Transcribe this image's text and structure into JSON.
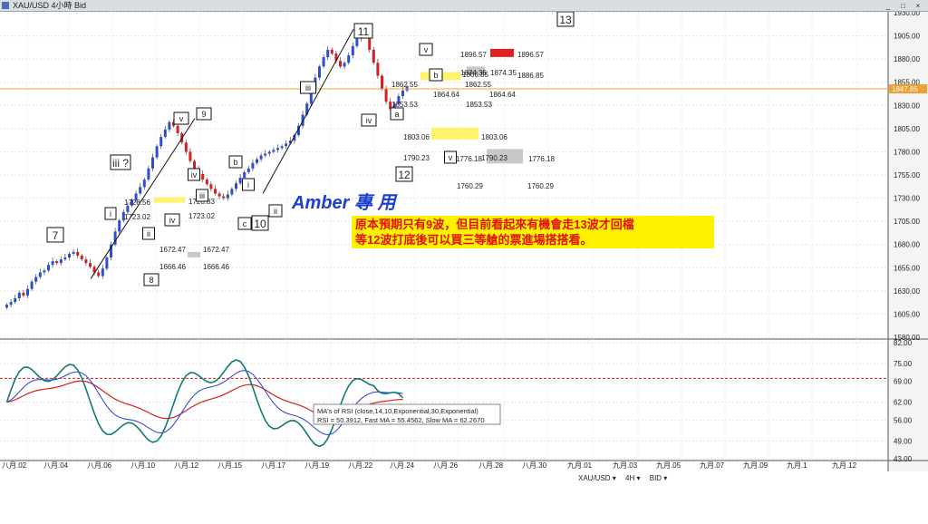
{
  "window": {
    "title": "XAU/USD 4小時 Bid",
    "min_label": "_",
    "max_label": "□",
    "close_label": "×"
  },
  "toolbar": {
    "symbol": "XAU/USD ▾",
    "timeframe": "4H ▾",
    "side": "BID ▾"
  },
  "watermark": {
    "text": "Amber 專 用"
  },
  "note": {
    "line1": "原本預期只有9波，但目前看起來有機會走13波才回檔",
    "line2": "等12波打底後可以買三等艙的票進場搭搭看。"
  },
  "current_price": {
    "label": "1847.85",
    "value": 1847.85
  },
  "chart_data": {
    "type": "candlestick",
    "price_axis": {
      "ticks": [
        "1930.00",
        "1905.00",
        "1880.00",
        "1855.00",
        "1830.00",
        "1805.00",
        "1780.00",
        "1755.00",
        "1730.00",
        "1705.00",
        "1680.00",
        "1655.00",
        "1630.00",
        "1605.00",
        "1580.00"
      ],
      "ylim": [
        1580,
        1930
      ]
    },
    "rsi_axis": {
      "ticks": [
        "82.00",
        "75.00",
        "69.00",
        "62.00",
        "56.00",
        "49.00",
        "43.00"
      ],
      "ylim": [
        43,
        82
      ]
    },
    "rsi_legend": {
      "line1": "MA's of RSI (close,14,10,Exponential,30,Exponential)",
      "line2": "RSI = 50.3912, Fast MA = 55.4562, Slow MA = 62.2670"
    },
    "x_labels": [
      "八月.02",
      "八月.04",
      "八月.06",
      "八月.10",
      "八月.12",
      "八月.15",
      "八月.17",
      "八月.19",
      "八月.22",
      "八月.24",
      "八月.26",
      "八月.28",
      "八月.30",
      "九月.01",
      "九月.03",
      "九月.05",
      "九月.07",
      "九月.09",
      "九月.1",
      "九月.12"
    ],
    "wave_labels": [
      "7",
      "8",
      "9",
      "10",
      "11",
      "12",
      "13",
      "i",
      "ii",
      "iii ?",
      "iv",
      "v",
      "iii",
      "iv",
      "a",
      "b",
      "c",
      "v",
      "b",
      "i",
      "ii",
      "iii",
      "iv",
      "v"
    ],
    "price_labels": [
      "1896.57",
      "1896.57",
      "1874.35",
      "1874.35",
      "1866.85",
      "1886.85",
      "1862.55",
      "1862.55",
      "1864.64",
      "1864.64",
      "1853.53",
      "1853.53",
      "1803.06",
      "1803.06",
      "1790.23",
      "1790.23",
      "1776.18",
      "1776.18",
      "1760.29",
      "1760.29",
      "1728.56",
      "1723.02",
      "1723.02",
      "1728.83",
      "1672.47",
      "1672.47",
      "1666.46",
      "1666.46"
    ],
    "close": [
      1615,
      1618,
      1622,
      1628,
      1625,
      1632,
      1640,
      1645,
      1650,
      1652,
      1658,
      1662,
      1660,
      1664,
      1666,
      1670,
      1672,
      1668,
      1664,
      1660,
      1656,
      1650,
      1646,
      1654,
      1666,
      1680,
      1694,
      1706,
      1715,
      1722,
      1728,
      1735,
      1742,
      1750,
      1762,
      1774,
      1786,
      1796,
      1804,
      1812,
      1808,
      1800,
      1790,
      1780,
      1770,
      1762,
      1756,
      1750,
      1745,
      1740,
      1735,
      1732,
      1730,
      1734,
      1740,
      1746,
      1752,
      1758,
      1762,
      1768,
      1772,
      1776,
      1778,
      1780,
      1782,
      1784,
      1786,
      1789,
      1792,
      1798,
      1808,
      1820,
      1832,
      1846,
      1860,
      1872,
      1882,
      1890,
      1886,
      1878,
      1872,
      1876,
      1884,
      1894,
      1902,
      1908,
      1904,
      1890,
      1876,
      1862,
      1848,
      1834,
      1826,
      1832,
      1840,
      1846,
      1850
    ]
  }
}
